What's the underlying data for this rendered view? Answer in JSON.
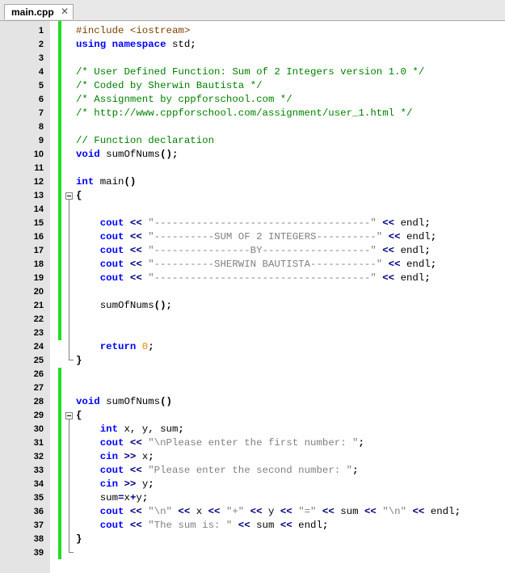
{
  "tab": {
    "label": "main.cpp",
    "close_glyph": "✕",
    "close_icon": "close-icon"
  },
  "lines": [
    {
      "n": "1",
      "tokens": [
        [
          "#include <iostream>",
          "pp"
        ]
      ]
    },
    {
      "n": "2",
      "tokens": [
        [
          "using",
          "kw"
        ],
        [
          " namespace ",
          "kw"
        ],
        [
          "std",
          "std"
        ],
        [
          ";",
          "punc"
        ]
      ]
    },
    {
      "n": "3",
      "tokens": []
    },
    {
      "n": "4",
      "tokens": [
        [
          "/* User Defined Function: Sum of 2 Integers version 1.0 */",
          "cm"
        ]
      ]
    },
    {
      "n": "5",
      "tokens": [
        [
          "/* Coded by Sherwin Bautista */",
          "cm"
        ]
      ]
    },
    {
      "n": "6",
      "tokens": [
        [
          "/* Assignment by cppforschool.com */",
          "cm"
        ]
      ]
    },
    {
      "n": "7",
      "tokens": [
        [
          "/* http://www.cppforschool.com/assignment/user_1.html */",
          "cm"
        ]
      ]
    },
    {
      "n": "8",
      "tokens": []
    },
    {
      "n": "9",
      "tokens": [
        [
          "// Function declaration",
          "cm"
        ]
      ]
    },
    {
      "n": "10",
      "tokens": [
        [
          "void",
          "kw"
        ],
        [
          " sumOfNums",
          "fn"
        ],
        [
          "();",
          "punc"
        ]
      ]
    },
    {
      "n": "11",
      "tokens": []
    },
    {
      "n": "12",
      "tokens": [
        [
          "int",
          "kw"
        ],
        [
          " main",
          "fn"
        ],
        [
          "()",
          "punc"
        ]
      ]
    },
    {
      "n": "13",
      "tokens": [
        [
          "{",
          "punc"
        ]
      ]
    },
    {
      "n": "14",
      "tokens": []
    },
    {
      "n": "15",
      "tokens": [
        [
          "    cout",
          "cout"
        ],
        [
          " << ",
          "op"
        ],
        [
          "\"------------------------------------\"",
          "str"
        ],
        [
          " << ",
          "op"
        ],
        [
          "endl",
          "endl"
        ],
        [
          ";",
          "punc"
        ]
      ]
    },
    {
      "n": "16",
      "tokens": [
        [
          "    cout",
          "cout"
        ],
        [
          " << ",
          "op"
        ],
        [
          "\"----------SUM OF 2 INTEGERS----------\"",
          "str"
        ],
        [
          " << ",
          "op"
        ],
        [
          "endl",
          "endl"
        ],
        [
          ";",
          "punc"
        ]
      ]
    },
    {
      "n": "17",
      "tokens": [
        [
          "    cout",
          "cout"
        ],
        [
          " << ",
          "op"
        ],
        [
          "\"----------------BY------------------\"",
          "str"
        ],
        [
          " << ",
          "op"
        ],
        [
          "endl",
          "endl"
        ],
        [
          ";",
          "punc"
        ]
      ]
    },
    {
      "n": "18",
      "tokens": [
        [
          "    cout",
          "cout"
        ],
        [
          " << ",
          "op"
        ],
        [
          "\"----------SHERWIN BAUTISTA-----------\"",
          "str"
        ],
        [
          " << ",
          "op"
        ],
        [
          "endl",
          "endl"
        ],
        [
          ";",
          "punc"
        ]
      ]
    },
    {
      "n": "19",
      "tokens": [
        [
          "    cout",
          "cout"
        ],
        [
          " << ",
          "op"
        ],
        [
          "\"------------------------------------\"",
          "str"
        ],
        [
          " << ",
          "op"
        ],
        [
          "endl",
          "endl"
        ],
        [
          ";",
          "punc"
        ]
      ]
    },
    {
      "n": "20",
      "tokens": []
    },
    {
      "n": "21",
      "tokens": [
        [
          "    sumOfNums",
          "fn"
        ],
        [
          "();",
          "punc"
        ]
      ]
    },
    {
      "n": "22",
      "tokens": []
    },
    {
      "n": "23",
      "tokens": []
    },
    {
      "n": "24",
      "tokens": [
        [
          "    return",
          "kw"
        ],
        [
          " 0",
          "num"
        ],
        [
          ";",
          "punc"
        ]
      ]
    },
    {
      "n": "25",
      "tokens": [
        [
          "}",
          "punc"
        ]
      ]
    },
    {
      "n": "26",
      "tokens": []
    },
    {
      "n": "27",
      "tokens": []
    },
    {
      "n": "28",
      "tokens": [
        [
          "void",
          "kw"
        ],
        [
          " sumOfNums",
          "fn"
        ],
        [
          "()",
          "punc"
        ]
      ]
    },
    {
      "n": "29",
      "tokens": [
        [
          "{",
          "punc"
        ]
      ]
    },
    {
      "n": "30",
      "tokens": [
        [
          "    int",
          "kw"
        ],
        [
          " x, y, sum",
          "id"
        ],
        [
          ";",
          "punc"
        ]
      ]
    },
    {
      "n": "31",
      "tokens": [
        [
          "    cout",
          "cout"
        ],
        [
          " << ",
          "op"
        ],
        [
          "\"\\nPlease enter the first number: \"",
          "str"
        ],
        [
          ";",
          "punc"
        ]
      ]
    },
    {
      "n": "32",
      "tokens": [
        [
          "    cin",
          "cin"
        ],
        [
          " >> ",
          "op"
        ],
        [
          "x",
          "id"
        ],
        [
          ";",
          "punc"
        ]
      ]
    },
    {
      "n": "33",
      "tokens": [
        [
          "    cout",
          "cout"
        ],
        [
          " << ",
          "op"
        ],
        [
          "\"Please enter the second number: \"",
          "str"
        ],
        [
          ";",
          "punc"
        ]
      ]
    },
    {
      "n": "34",
      "tokens": [
        [
          "    cin",
          "cin"
        ],
        [
          " >> ",
          "op"
        ],
        [
          "y",
          "id"
        ],
        [
          ";",
          "punc"
        ]
      ]
    },
    {
      "n": "35",
      "tokens": [
        [
          "    sum",
          "id"
        ],
        [
          "=",
          "op"
        ],
        [
          "x",
          "id"
        ],
        [
          "+",
          "op"
        ],
        [
          "y",
          "id"
        ],
        [
          ";",
          "punc"
        ]
      ]
    },
    {
      "n": "36",
      "tokens": [
        [
          "    cout",
          "cout"
        ],
        [
          " << ",
          "op"
        ],
        [
          "\"\\n\"",
          "str"
        ],
        [
          " << ",
          "op"
        ],
        [
          "x",
          "id"
        ],
        [
          " << ",
          "op"
        ],
        [
          "\"+\"",
          "str"
        ],
        [
          " << ",
          "op"
        ],
        [
          "y",
          "id"
        ],
        [
          " << ",
          "op"
        ],
        [
          "\"=\"",
          "str"
        ],
        [
          " << ",
          "op"
        ],
        [
          "sum",
          "id"
        ],
        [
          " << ",
          "op"
        ],
        [
          "\"\\n\"",
          "str"
        ],
        [
          " << ",
          "op"
        ],
        [
          "endl",
          "endl"
        ],
        [
          ";",
          "punc"
        ]
      ]
    },
    {
      "n": "37",
      "tokens": [
        [
          "    cout",
          "cout"
        ],
        [
          " << ",
          "op"
        ],
        [
          "\"The sum is: \"",
          "str"
        ],
        [
          " << ",
          "op"
        ],
        [
          "sum",
          "id"
        ],
        [
          " << ",
          "op"
        ],
        [
          "endl",
          "endl"
        ],
        [
          ";",
          "punc"
        ]
      ]
    },
    {
      "n": "38",
      "tokens": [
        [
          "}",
          "punc"
        ]
      ]
    },
    {
      "n": "39",
      "tokens": []
    }
  ],
  "colors": {
    "gutter_bg": "#e4e4e4",
    "change_bar": "#22dd22",
    "keyword": "#0000ff",
    "string": "#808080",
    "comment": "#008000",
    "preprocessor": "#804000",
    "number": "#ff8000",
    "operator": "#000080"
  }
}
